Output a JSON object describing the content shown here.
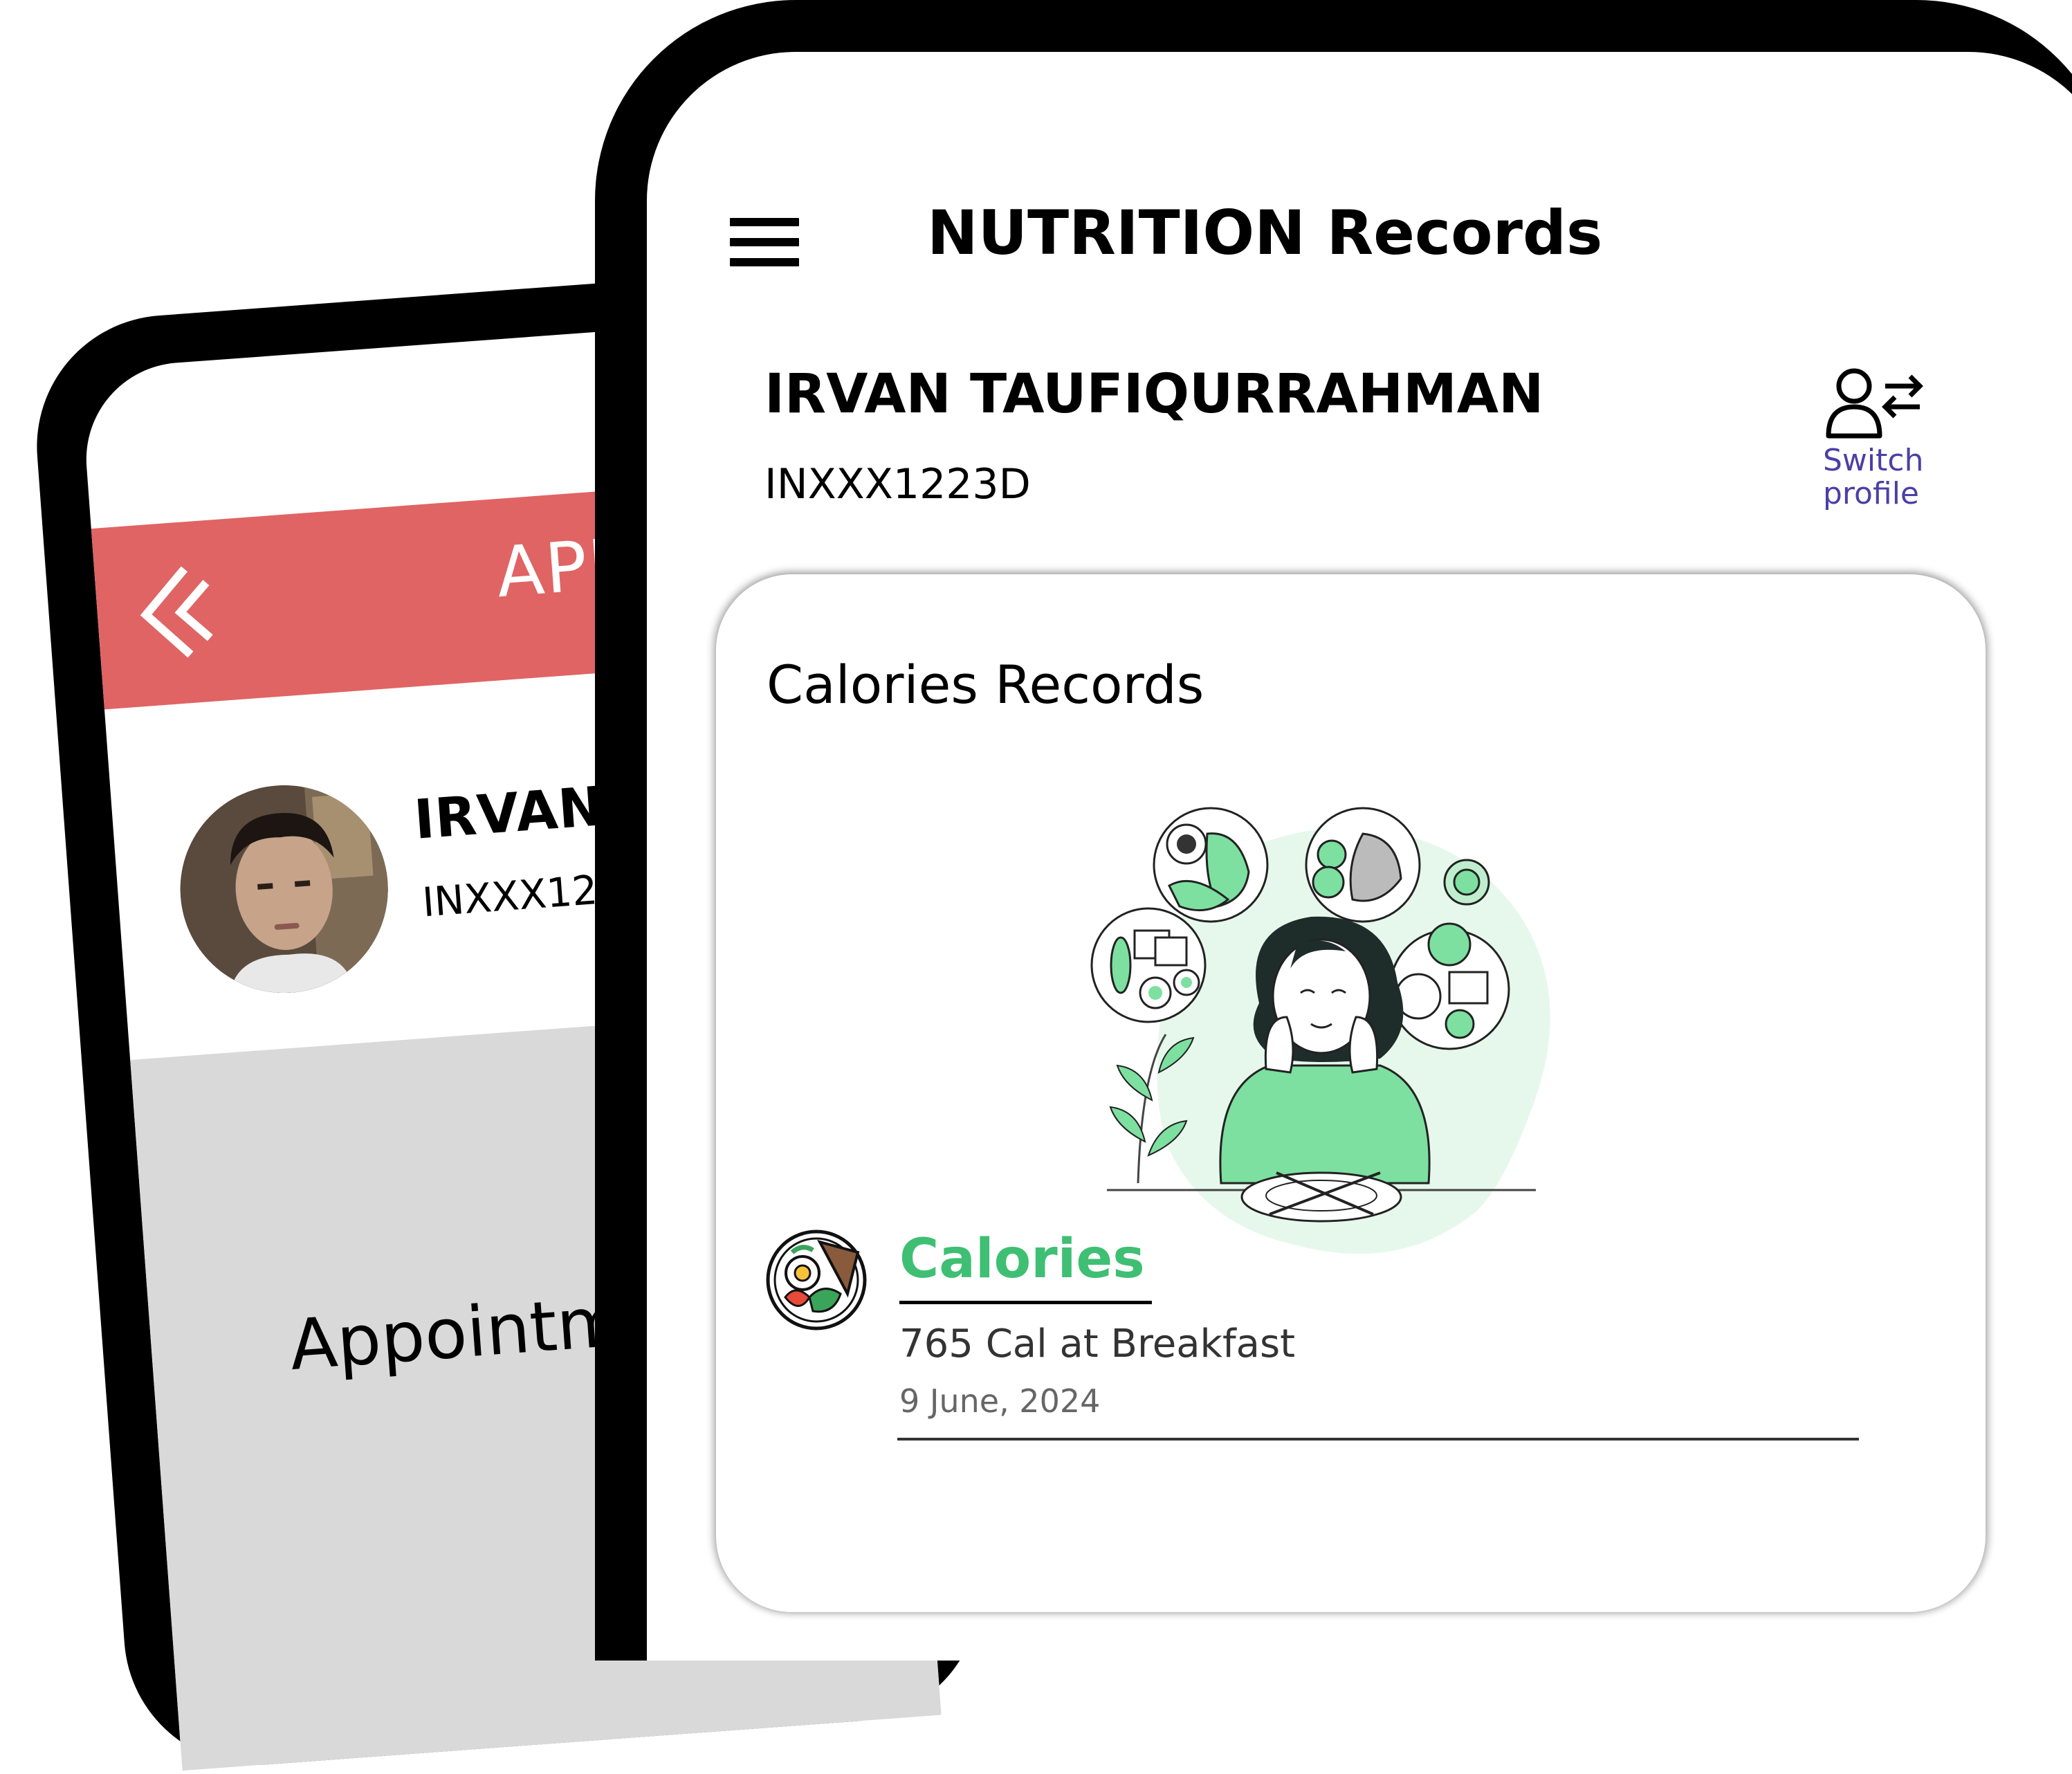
{
  "back_screen": {
    "title": "APPO",
    "patient_name": "IRVAN TA",
    "patient_id": "INXXX1223D",
    "section_title": "Appointmen",
    "colors": {
      "header": "#e06464",
      "gray_area": "#d9d9d9"
    }
  },
  "front_screen": {
    "header": {
      "menu_icon": "hamburger-menu-icon",
      "title": "NUTRITION Records"
    },
    "patient": {
      "name": "IRVAN TAUFIQURRAHMAN",
      "id": "INXXX1223D"
    },
    "switch_profile": {
      "icon": "switch-profile-icon",
      "label": "Switch profile",
      "color": "#4b3fa6"
    },
    "card": {
      "title": "Calories Records",
      "illustration": "woman-thinking-about-food-illustration",
      "entry": {
        "icon": "food-plate-icon",
        "title": "Calories",
        "description": "765 Cal at Breakfast",
        "date": "9 June, 2024",
        "accent_color": "#3fbf73"
      }
    }
  }
}
